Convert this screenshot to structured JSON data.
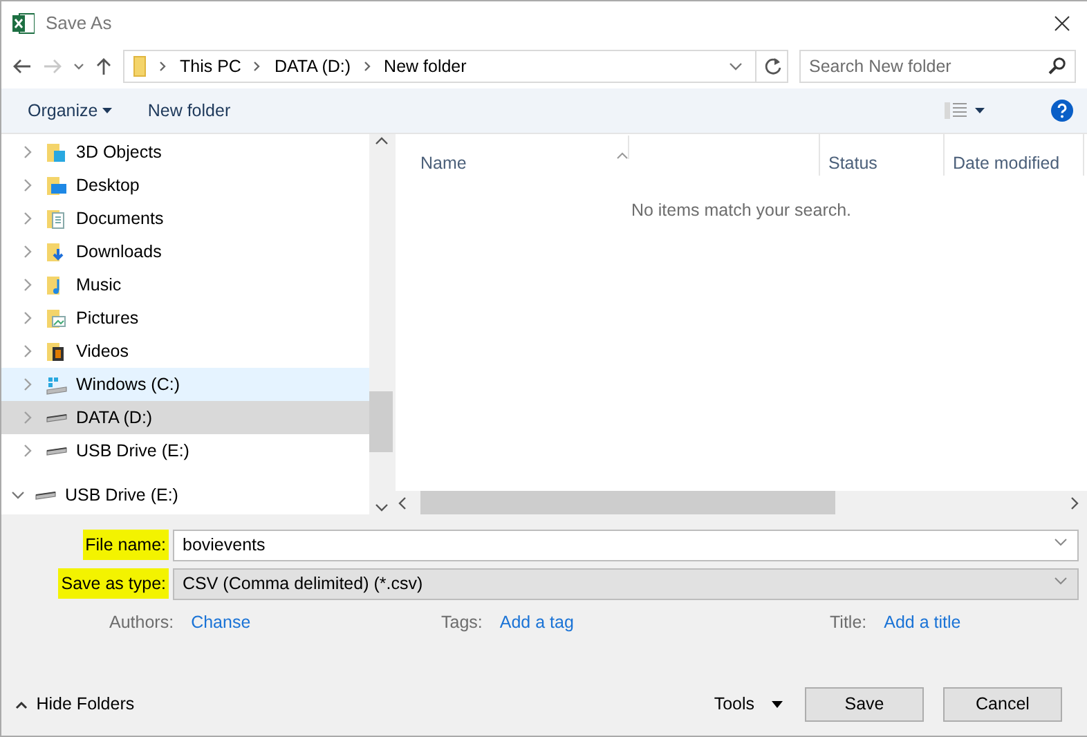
{
  "window": {
    "title": "Save As"
  },
  "address": {
    "segments": [
      "This PC",
      "DATA (D:)",
      "New folder"
    ],
    "search_placeholder": "Search New folder"
  },
  "toolbar": {
    "organize": "Organize",
    "new_folder": "New folder"
  },
  "nav": {
    "items": [
      {
        "label": "3D Objects",
        "kind": "objects",
        "selected": false,
        "hovered": false
      },
      {
        "label": "Desktop",
        "kind": "desktop",
        "selected": false,
        "hovered": false
      },
      {
        "label": "Documents",
        "kind": "documents",
        "selected": false,
        "hovered": false
      },
      {
        "label": "Downloads",
        "kind": "downloads",
        "selected": false,
        "hovered": false
      },
      {
        "label": "Music",
        "kind": "music",
        "selected": false,
        "hovered": false
      },
      {
        "label": "Pictures",
        "kind": "pictures",
        "selected": false,
        "hovered": false
      },
      {
        "label": "Videos",
        "kind": "videos",
        "selected": false,
        "hovered": false
      },
      {
        "label": "Windows (C:)",
        "kind": "system-drive",
        "selected": false,
        "hovered": true
      },
      {
        "label": "DATA (D:)",
        "kind": "drive",
        "selected": true,
        "hovered": false
      },
      {
        "label": "USB Drive (E:)",
        "kind": "drive",
        "selected": false,
        "hovered": false
      }
    ],
    "root_items": [
      {
        "label": "USB Drive (E:)",
        "kind": "drive",
        "expanded": true
      }
    ]
  },
  "list": {
    "columns": [
      "Name",
      "Status",
      "Date modified"
    ],
    "empty_message": "No items match your search."
  },
  "fields": [
    {
      "label": "File name:",
      "value": "bovievents",
      "highlighted": true,
      "editable": true
    },
    {
      "label": "Save as type:",
      "value": "CSV (Comma delimited) (*.csv)",
      "highlighted": true,
      "editable": false
    }
  ],
  "meta": [
    {
      "label": "Authors:",
      "value": "Chanse"
    },
    {
      "label": "Tags:",
      "value": "Add a tag"
    },
    {
      "label": "Title:",
      "value": "Add a title"
    }
  ],
  "footer": {
    "hide_folders": "Hide Folders",
    "tools": "Tools",
    "buttons": [
      "Save",
      "Cancel"
    ]
  }
}
